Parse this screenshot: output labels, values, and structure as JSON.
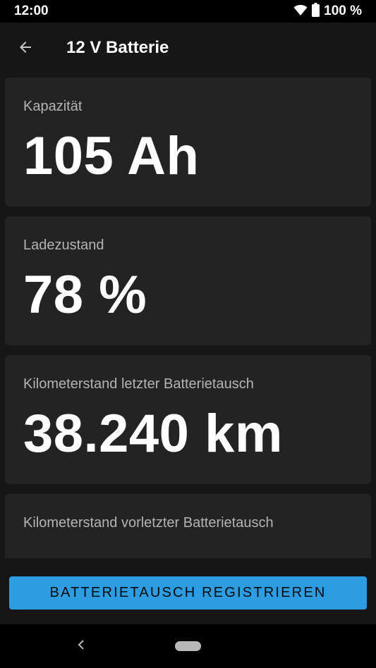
{
  "status_bar": {
    "time": "12:00",
    "battery_text": "100 %",
    "icons": [
      "wifi-icon",
      "battery-icon"
    ]
  },
  "app_bar": {
    "title": "12 V Batterie",
    "back_icon": "arrow-left-icon"
  },
  "cards": [
    {
      "label": "Kapazität",
      "value": "105 Ah"
    },
    {
      "label": "Ladezustand",
      "value": "78 %"
    },
    {
      "label": "Kilometerstand letzter Batterietausch",
      "value": "38.240 km"
    },
    {
      "label": "Kilometerstand vorletzter Batterietausch",
      "value": ""
    }
  ],
  "action": {
    "button_label": "BATTERIETAUSCH REGISTRIEREN"
  },
  "nav_bar": {
    "icons": [
      "nav-back-icon",
      "nav-home-pill"
    ]
  },
  "colors": {
    "background": "#161616",
    "card": "#232323",
    "accent": "#2d9ce0",
    "label": "#b4b4b4"
  }
}
